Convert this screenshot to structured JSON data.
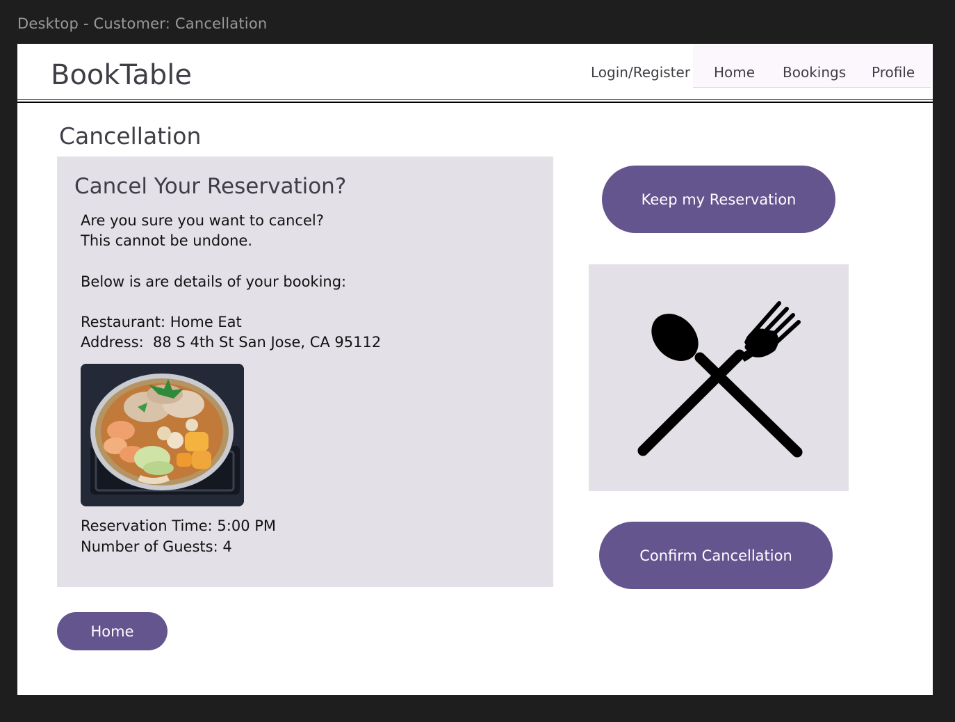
{
  "frame": {
    "label": "Desktop - Customer: Cancellation"
  },
  "header": {
    "brand": "BookTable",
    "login_label": "Login/Register",
    "tabs": [
      {
        "label": "Home"
      },
      {
        "label": "Bookings"
      },
      {
        "label": "Profile"
      }
    ]
  },
  "page": {
    "title": "Cancellation"
  },
  "card": {
    "title": "Cancel Your Reservation?",
    "confirm_question": "Are you sure you want to cancel?",
    "warning": "This cannot be undone.",
    "details_intro": "Below is are details of your booking:",
    "restaurant": "Restaurant: Home Eat",
    "address": "Address:  88 S 4th St San Jose, CA 95112",
    "reservation_time": "Reservation Time: 5:00 PM",
    "guests": "Number of Guests: 4"
  },
  "buttons": {
    "keep": "Keep my Reservation",
    "confirm": "Confirm Cancellation",
    "home": "Home"
  },
  "icons": {
    "panel": "spoon-fork-crossed-icon"
  },
  "colors": {
    "primary": "#65558f",
    "card_bg": "#e3e0e7",
    "nav_bg": "#fcf6fd"
  }
}
